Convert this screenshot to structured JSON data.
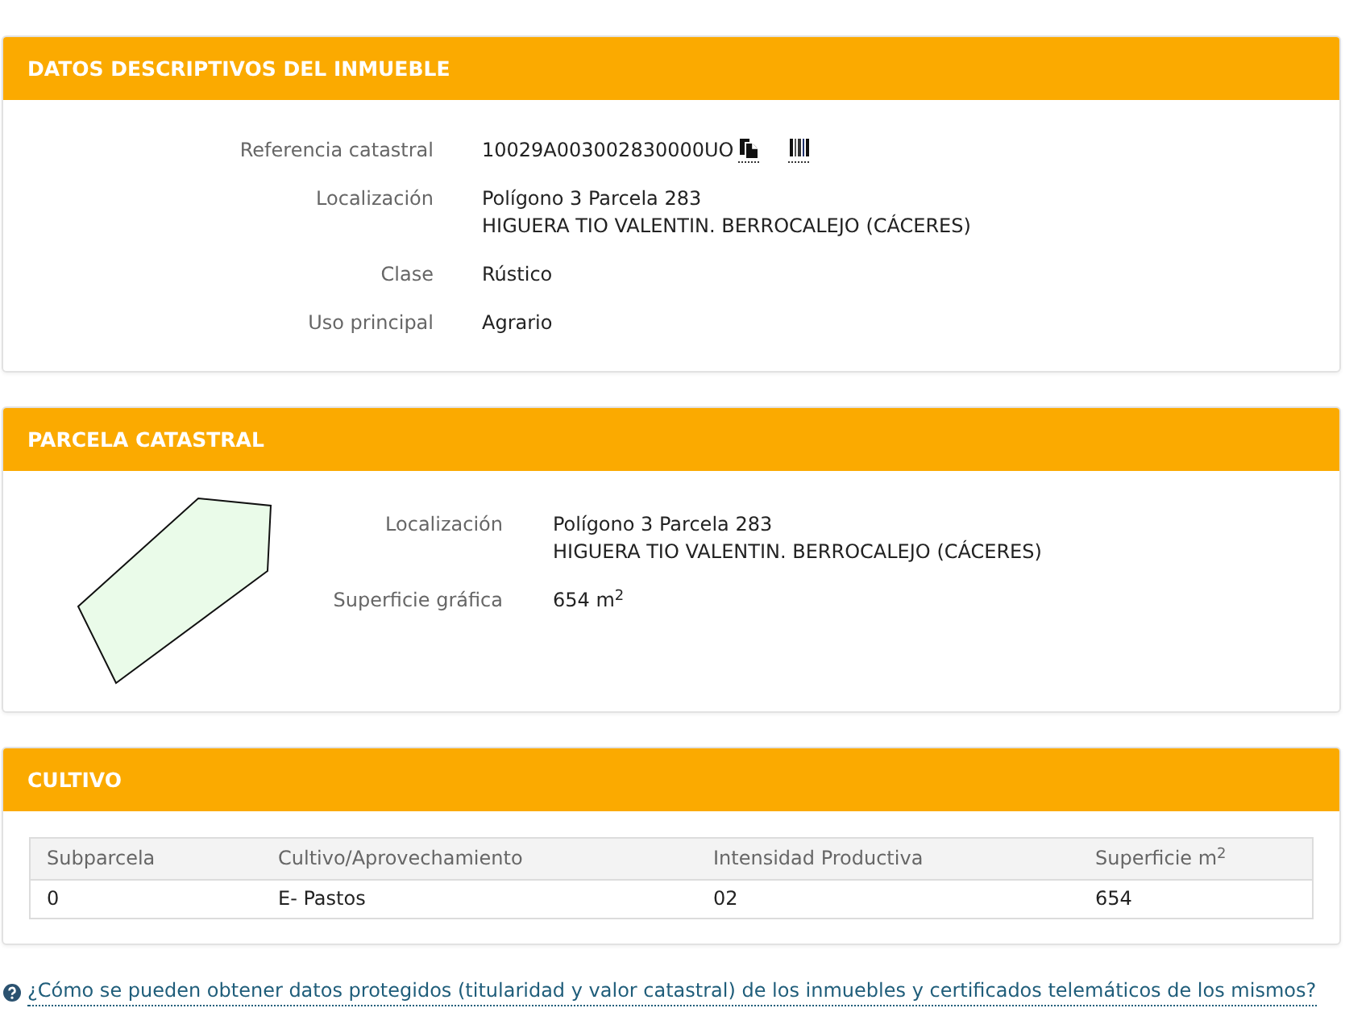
{
  "sections": [
    {
      "kind": "details",
      "title": "DATOS DESCRIPTIVOS DEL INMUEBLE",
      "fields": [
        {
          "kind": "reference",
          "label": "Referencia catastral",
          "lines": [
            "10029A003002830000UO"
          ]
        },
        {
          "kind": "text",
          "label": "Localización",
          "lines": [
            "Polígono 3 Parcela 283",
            "HIGUERA TIO VALENTIN. BERROCALEJO (CÁCERES)"
          ]
        },
        {
          "kind": "text",
          "label": "Clase",
          "lines": [
            "Rústico"
          ]
        },
        {
          "kind": "text",
          "label": "Uso principal",
          "lines": [
            "Agrario"
          ]
        }
      ]
    },
    {
      "kind": "parcel",
      "title": "PARCELA CATASTRAL",
      "fields": [
        {
          "kind": "text",
          "label": "Localización",
          "lines": [
            "Polígono 3 Parcela 283",
            "HIGUERA TIO VALENTIN. BERROCALEJO (CÁCERES)"
          ]
        },
        {
          "kind": "text",
          "label": "Superficie gráfica",
          "lines": [
            "654 m$^{2}$"
          ]
        }
      ]
    },
    {
      "kind": "table",
      "title": "CULTIVO",
      "columns": [
        "Subparcela",
        "Cultivo/Aprovechamiento",
        "Intensidad Productiva",
        "Superficie m$^{2}$"
      ],
      "rows": [
        [
          "0",
          "E- Pastos",
          "02",
          "654"
        ]
      ]
    }
  ],
  "help_link": "¿Cómo se pueden obtener datos protegidos (titularidad y valor catastral) de los inmuebles y certificados telemáticos de los mismos?"
}
